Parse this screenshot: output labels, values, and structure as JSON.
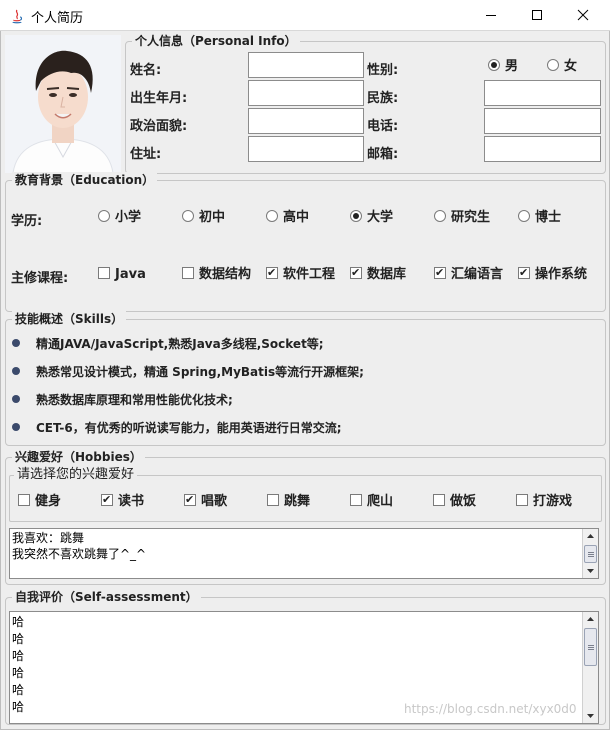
{
  "window": {
    "title": "个人简历"
  },
  "personal": {
    "legend": "个人信息（Personal Info）",
    "name_label": "姓名:",
    "birth_label": "出生年月:",
    "politics_label": "政治面貌:",
    "address_label": "住址:",
    "gender_label": "性别:",
    "ethnicity_label": "民族:",
    "phone_label": "电话:",
    "email_label": "邮箱:",
    "gender_options": [
      "男",
      "女"
    ],
    "gender_selected": "男",
    "name_value": "",
    "birth_value": "",
    "politics_value": "",
    "address_value": "",
    "ethnicity_value": "",
    "phone_value": "",
    "email_value": ""
  },
  "education": {
    "legend": "教育背景（Education）",
    "degree_label": "学历:",
    "degrees": [
      "小学",
      "初中",
      "高中",
      "大学",
      "研究生",
      "博士"
    ],
    "degree_selected": "大学",
    "courses_label": "主修课程:",
    "courses": [
      {
        "label": "Java",
        "checked": false
      },
      {
        "label": "数据结构",
        "checked": false
      },
      {
        "label": "软件工程",
        "checked": true
      },
      {
        "label": "数据库",
        "checked": true
      },
      {
        "label": "汇编语言",
        "checked": true
      },
      {
        "label": "操作系统",
        "checked": true
      }
    ]
  },
  "skills": {
    "legend": "技能概述（Skills）",
    "items": [
      "精通JAVA/JavaScript,熟悉Java多线程,Socket等;",
      "熟悉常见设计模式，精通 Spring,MyBatis等流行开源框架;",
      "熟悉数据库原理和常用性能优化技术;",
      "CET-6，有优秀的听说读写能力，能用英语进行日常交流;"
    ]
  },
  "hobbies": {
    "legend": "兴趣爱好（Hobbies）",
    "inner_legend": "请选择您的兴趣爱好",
    "options": [
      {
        "label": "健身",
        "checked": false
      },
      {
        "label": "读书",
        "checked": true
      },
      {
        "label": "唱歌",
        "checked": true
      },
      {
        "label": "跳舞",
        "checked": false
      },
      {
        "label": "爬山",
        "checked": false
      },
      {
        "label": "做饭",
        "checked": false
      },
      {
        "label": "打游戏",
        "checked": false
      }
    ],
    "text_lines": [
      "我喜欢：跳舞",
      "我突然不喜欢跳舞了^_^"
    ]
  },
  "assessment": {
    "legend": "自我评价（Self-assessment）",
    "text_lines": [
      "哈",
      "哈",
      "哈",
      "哈",
      "哈",
      "哈"
    ]
  },
  "watermark": "https://blog.csdn.net/xyx0d0",
  "colors": {
    "background": "#eeeeee",
    "border": "#c6c6c6",
    "field_bg": "#ffffff",
    "bullet": "#3b4a6b"
  },
  "icons": [
    "java-app-icon",
    "minimize-icon",
    "maximize-icon",
    "close-icon",
    "scroll-up-icon",
    "scroll-down-icon"
  ]
}
